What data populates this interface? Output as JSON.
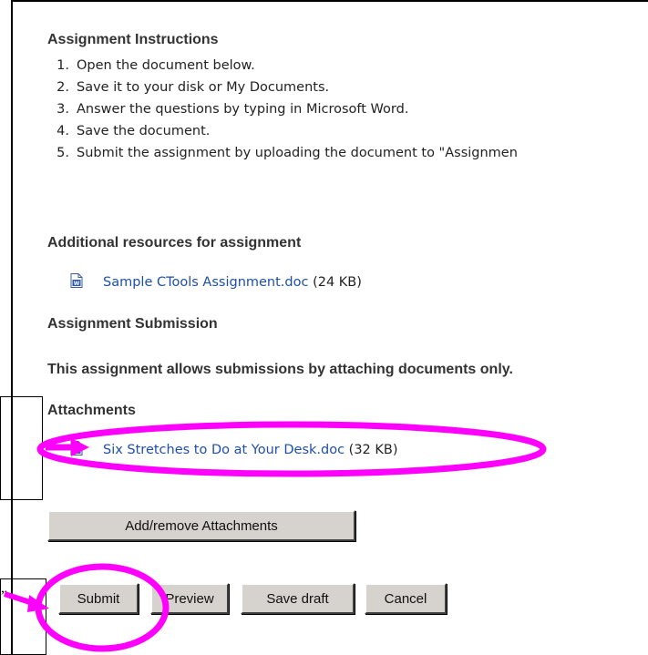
{
  "headings": {
    "instructions": "Assignment Instructions",
    "resources": "Additional resources for assignment",
    "submission": "Assignment Submission",
    "allows": "This assignment allows submissions by attaching documents only.",
    "attachments": "Attachments"
  },
  "instructions": [
    {
      "num": "1.",
      "text": "Open the document below."
    },
    {
      "num": "2.",
      "text": "Save it to your disk or My Documents."
    },
    {
      "num": "3.",
      "text": "Answer the questions by typing in Microsoft Word."
    },
    {
      "num": "4.",
      "text": "Save the document."
    },
    {
      "num": "5.",
      "text": "Submit the assignment by uploading the document to \"Assignmen"
    }
  ],
  "resource_file": {
    "name": "Sample CTools Assignment.doc",
    "size": "(24 KB)",
    "icon": "word-doc-icon"
  },
  "attachment_file": {
    "name": "Six Stretches to Do at Your Desk.doc",
    "size": "(32 KB)",
    "icon": "word-doc-icon"
  },
  "buttons": {
    "add_remove": "Add/remove Attachments",
    "submit": "Submit",
    "preview": "Preview",
    "save_draft": "Save draft",
    "cancel": "Cancel"
  },
  "callout_fragment": "”",
  "colors": {
    "highlight": "#ff00ff",
    "link": "#1f4fa8",
    "button_face": "#d6d3ce"
  }
}
